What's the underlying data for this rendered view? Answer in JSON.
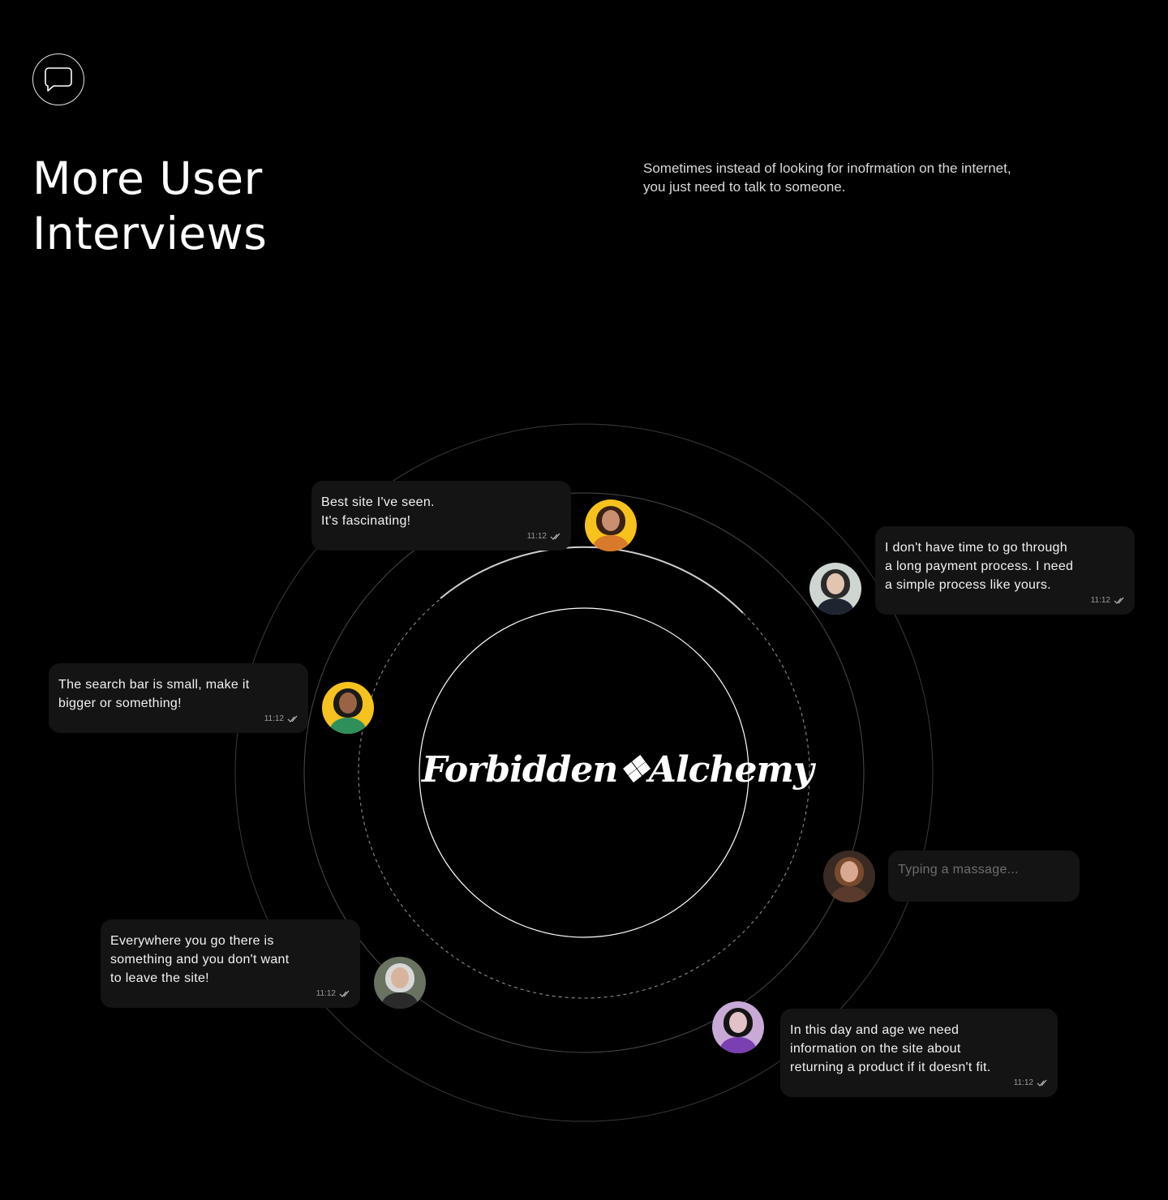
{
  "header": {
    "icon": "chat-bubble-icon",
    "title_line1": "More User",
    "title_line2": "Interviews",
    "subtitle_line1": "Sometimes instead of looking for inofrmation on the internet,",
    "subtitle_line2": "you just need to talk to someone."
  },
  "brand": {
    "name": "Forbidden❖Alchemy"
  },
  "messages": [
    {
      "line1": "Best site I've seen.",
      "line2": "It's fascinating!",
      "time": "11:12",
      "status_icon": "double-check-icon"
    },
    {
      "line1": "I don't have time to go through",
      "line2": "a long payment process. I need",
      "line3": "a simple process like yours.",
      "time": "11:12",
      "status_icon": "double-check-icon"
    },
    {
      "line1": "The search bar is small, make it",
      "line2": "bigger or something!",
      "time": "11:12",
      "status_icon": "double-check-icon"
    },
    {
      "typing": "Typing a massage..."
    },
    {
      "line1": "Everywhere you go there is",
      "line2": "something and you don't want",
      "line3": "to leave the site!",
      "time": "11:12",
      "status_icon": "double-check-icon"
    },
    {
      "line1": "In this day and age we need",
      "line2": "information on the site about",
      "line3": "returning a product if it doesn't fit.",
      "time": "11:12",
      "status_icon": "double-check-icon"
    }
  ],
  "colors": {
    "background": "#000000",
    "bubble": "#141414",
    "avatar_yellow": "#f6c21d"
  }
}
